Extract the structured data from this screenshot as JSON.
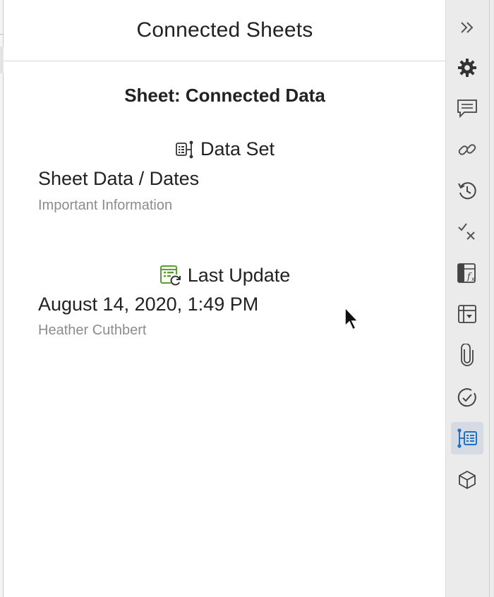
{
  "panel": {
    "title": "Connected Sheets",
    "sheet_label": "Sheet: Connected Data"
  },
  "data_set": {
    "heading": "Data Set",
    "icon": "dataset-icon",
    "name": "Sheet Data / Dates",
    "description": "Important Information"
  },
  "last_update": {
    "heading": "Last Update",
    "icon": "sheet-refresh-icon",
    "timestamp": "August 14, 2020, 1:49 PM",
    "user": "Heather Cuthbert"
  },
  "rail": {
    "items": [
      {
        "icon": "collapse-chevrons-icon"
      },
      {
        "icon": "gear-icon"
      },
      {
        "icon": "comments-icon"
      },
      {
        "icon": "link-icon"
      },
      {
        "icon": "history-icon"
      },
      {
        "icon": "proofing-icon"
      },
      {
        "icon": "sheet-formula-icon"
      },
      {
        "icon": "sheet-summary-icon"
      },
      {
        "icon": "attachment-icon"
      },
      {
        "icon": "approval-icon"
      },
      {
        "icon": "connected-sheets-icon",
        "active": true
      },
      {
        "icon": "cube-icon"
      }
    ]
  },
  "colors": {
    "accent": "#1a73c8",
    "green": "#5aa02c",
    "icon": "#444444"
  }
}
